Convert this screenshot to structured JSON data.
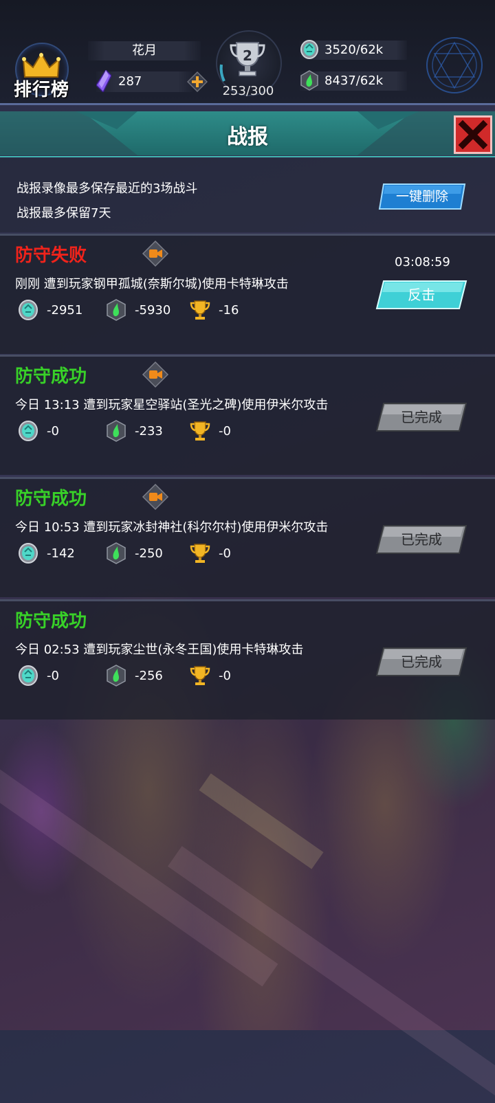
{
  "topbar": {
    "rank_label": "排行榜",
    "player_name": "花月",
    "gems": "287",
    "trophy_level": "2",
    "trophy_count": "253/300",
    "coin_resource": "3520/62k",
    "elixir_resource": "8437/62k"
  },
  "header": {
    "title": "战报"
  },
  "info": {
    "line1": "战报录像最多保存最近的3场战斗",
    "line2": "战报最多保留7天",
    "delete_all_label": "一键删除"
  },
  "reports": [
    {
      "status": "防守失败",
      "status_type": "fail",
      "timer": "03:08:59",
      "description": "刚刚 遭到玩家钢甲孤城(奈斯尔城)使用卡特琳攻击",
      "coin": "-2951",
      "elixir": "-5930",
      "trophy": "-16",
      "action_label": "反击",
      "action_enabled": true
    },
    {
      "status": "防守成功",
      "status_type": "ok",
      "timer": "",
      "description": "今日 13:13 遭到玩家星空驿站(圣光之碑)使用伊米尔攻击",
      "coin": "-0",
      "elixir": "-233",
      "trophy": "-0",
      "action_label": "已完成",
      "action_enabled": false
    },
    {
      "status": "防守成功",
      "status_type": "ok",
      "timer": "",
      "description": "今日 10:53 遭到玩家冰封神社(科尔尔村)使用伊米尔攻击",
      "coin": "-142",
      "elixir": "-250",
      "trophy": "-0",
      "action_label": "已完成",
      "action_enabled": false
    },
    {
      "status": "防守成功",
      "status_type": "ok",
      "timer": "",
      "description": "今日 02:53 遭到玩家尘世(永冬王国)使用卡特琳攻击",
      "coin": "-0",
      "elixir": "-256",
      "trophy": "-0",
      "action_label": "已完成",
      "action_enabled": false
    }
  ],
  "colors": {
    "fail": "#f0231b",
    "success": "#38d128",
    "header_teal": "#2e8c89",
    "counter_button": "#3fd0d6",
    "done_button": "#8a8d92"
  }
}
